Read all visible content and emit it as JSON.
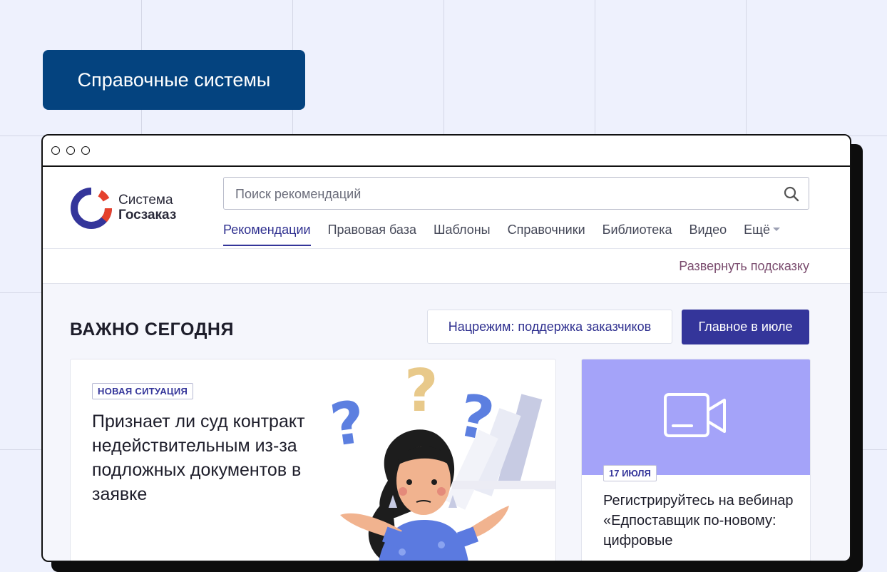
{
  "badge": {
    "label": "Справочные системы"
  },
  "logo": {
    "line1": "Система",
    "line2": "Госзаказ"
  },
  "search": {
    "placeholder": "Поиск рекомендаций"
  },
  "nav": {
    "items": [
      "Рекомендации",
      "Правовая база",
      "Шаблоны",
      "Справочники",
      "Библиотека",
      "Видео",
      "Ещё"
    ],
    "active_index": 0
  },
  "hint": {
    "label": "Развернуть подсказку"
  },
  "section": {
    "title": "ВАЖНО СЕГОДНЯ"
  },
  "buttons": {
    "outline": "Нацрежим: поддержка заказчиков",
    "primary": "Главное в июле"
  },
  "card": {
    "tag": "НОВАЯ СИТУАЦИЯ",
    "title": "Признает ли суд контракт недействительным из-за подложных документов в заявке"
  },
  "side": {
    "date": "17 ИЮЛЯ",
    "text": "Регистрируйтесь на вебинар «Едпоставщик по-новому: цифровые"
  },
  "icons": [
    "search-icon",
    "video-camera-icon",
    "chevron-down-icon",
    "logo-icon"
  ],
  "colors": {
    "brand_blue": "#04437f",
    "primary": "#34359a",
    "accent_red": "#e5412d",
    "video_bg": "#a4a3f9",
    "hint": "#7a4c6e"
  }
}
